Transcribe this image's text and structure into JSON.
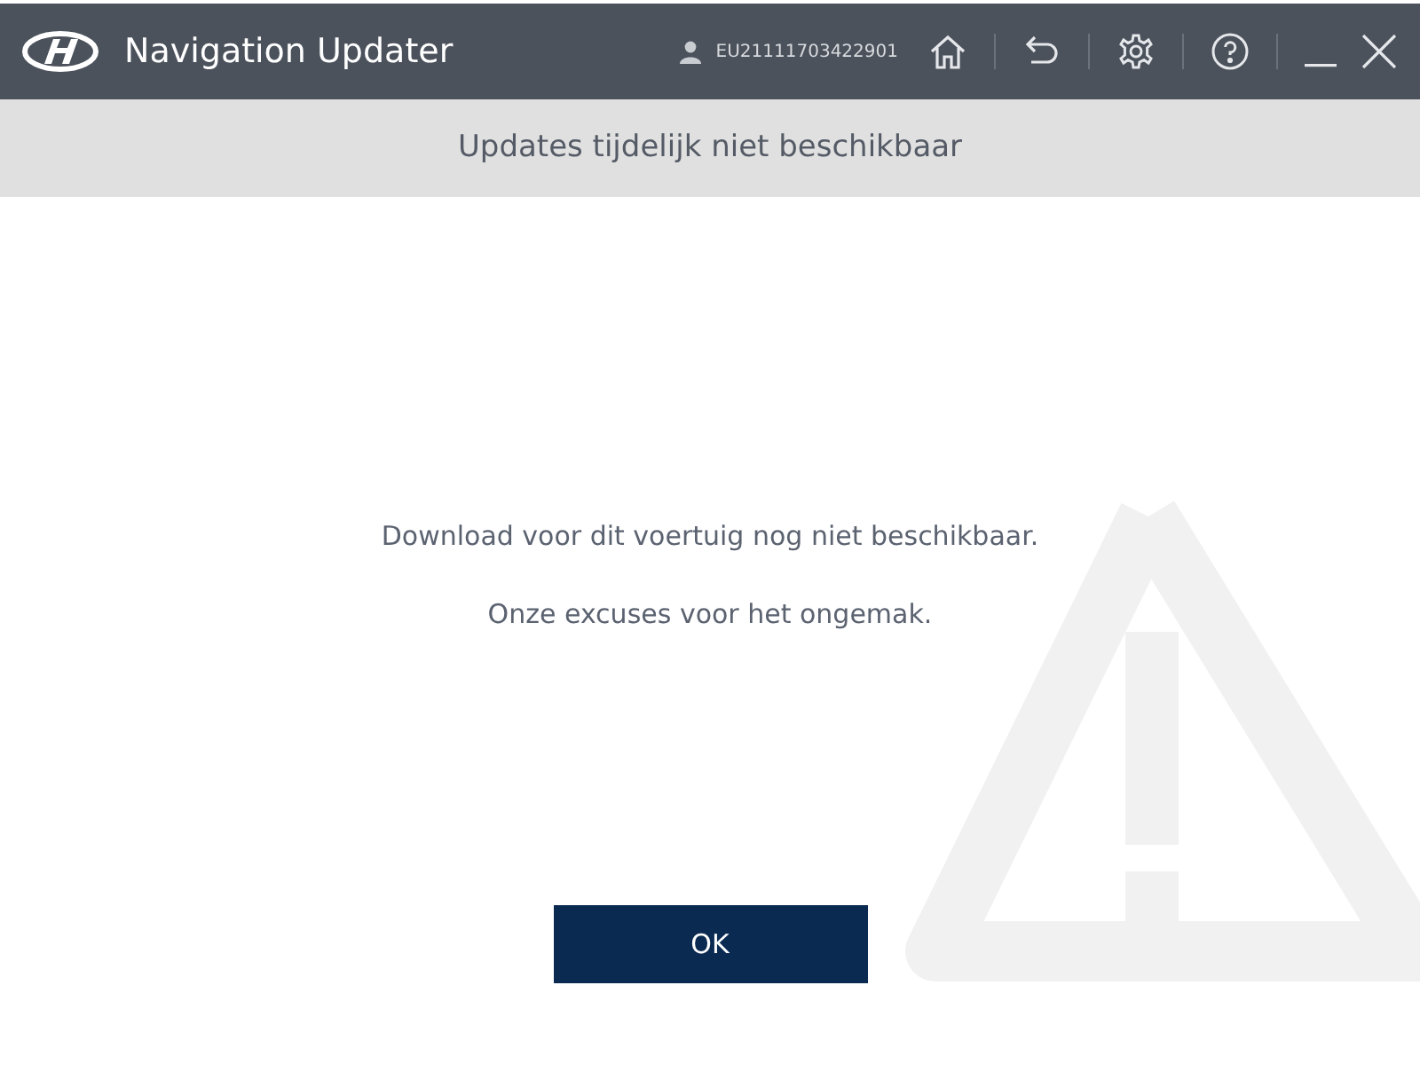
{
  "window": {
    "title": "Navigation Updater",
    "user_id": "EU21111703422901"
  },
  "header": {
    "title": "Updates tijdelijk niet beschikbaar"
  },
  "message": {
    "lines": [
      "Download voor dit voertuig nog niet beschikbaar.",
      "Onze excuses voor het ongemak."
    ]
  },
  "buttons": [
    "OK"
  ]
}
